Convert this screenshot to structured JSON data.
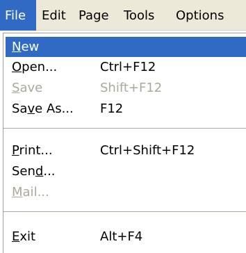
{
  "menubar": {
    "items": [
      {
        "label": "File",
        "active": true
      },
      {
        "label": "Edit"
      },
      {
        "label": "Page"
      },
      {
        "label": "Tools"
      },
      {
        "label": "Options"
      }
    ]
  },
  "file_menu": {
    "items": [
      {
        "pre": "",
        "mnemonic": "N",
        "post": "ew",
        "shortcut": "",
        "state": "highlighted"
      },
      {
        "pre": "",
        "mnemonic": "O",
        "post": "pen...",
        "shortcut": "Ctrl+F12",
        "state": "enabled"
      },
      {
        "pre": "",
        "mnemonic": "S",
        "post": "ave",
        "shortcut": "Shift+F12",
        "state": "disabled"
      },
      {
        "pre": "Sa",
        "mnemonic": "v",
        "post": "e As...",
        "shortcut": "F12",
        "state": "enabled"
      },
      {
        "pre": "",
        "mnemonic": "P",
        "post": "rint...",
        "shortcut": "Ctrl+Shift+F12",
        "state": "enabled"
      },
      {
        "pre": "Sen",
        "mnemonic": "d",
        "post": "...",
        "shortcut": "",
        "state": "enabled"
      },
      {
        "pre": "",
        "mnemonic": "M",
        "post": "ail...",
        "shortcut": "",
        "state": "disabled"
      },
      {
        "pre": "",
        "mnemonic": "E",
        "post": "xit",
        "shortcut": "Alt+F4",
        "state": "enabled"
      }
    ]
  },
  "colors": {
    "highlight": "#316ac5",
    "menubar_bg": "#ece9d8",
    "disabled_text": "#aca899"
  }
}
